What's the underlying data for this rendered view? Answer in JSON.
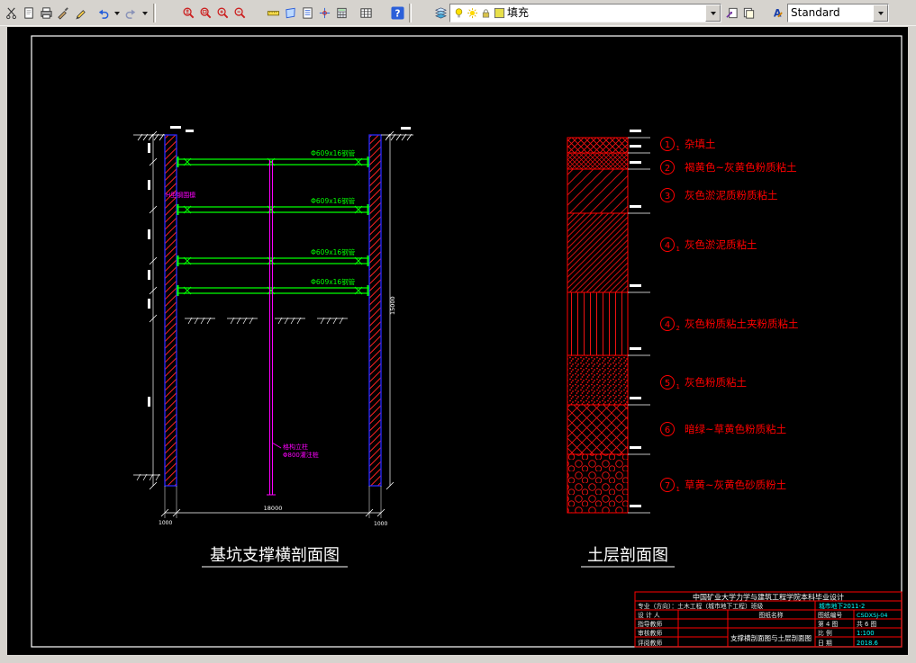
{
  "toolbar": {
    "layer_combo_value": "填充",
    "style_combo_value": "Standard",
    "help_glyph": "?",
    "text_style_glyph": "A",
    "icons": {
      "cut-icon": "scissors",
      "new-icon": "blank page",
      "print-icon": "printer",
      "matchprop-icon": "paint brush",
      "pencil-icon": "pencil",
      "undo-icon": "curved arrow left",
      "redo-icon": "curved arrow right",
      "zoom-realtime-icon": "red magnifier plus-minus",
      "zoom-window-icon": "red magnifier with window",
      "zoom-in-icon": "red magnifier plus",
      "zoom-out-icon": "red magnifier minus",
      "measure-icon": "ruler",
      "area-icon": "polygon",
      "list-icon": "page with lines",
      "point-icon": "crosshair",
      "calc-icon": "calculator grid",
      "table-icon": "table grid",
      "help-icon": "blue question mark",
      "layers-stack-icon": "stacked sheets",
      "bulb-icon": "lightbulb on",
      "sun-icon": "sun",
      "lock-icon": "padlock",
      "layer-color-swatch": "yellow square",
      "dropdown-arrow-icon": "down triangle"
    }
  },
  "drawing": {
    "section": {
      "title": "基坑支撑横剖面图",
      "strut_labels": [
        "Φ609x16钢管",
        "Φ609x16钢管",
        "Φ609x16钢管",
        "Φ609x16钢管"
      ],
      "waler_label": "H型钢围檩",
      "pile_label_line1": "格构立柱",
      "pile_label_line2": "Φ800灌注桩",
      "dim_bottom_left": "1000",
      "dim_bottom_center": "18000",
      "dim_bottom_right": "1000",
      "dim_right": "15000"
    },
    "soil": {
      "title": "土层剖面图",
      "layers": [
        {
          "num": "1",
          "sub": "1",
          "label": "杂填土",
          "pattern": "crosshatch"
        },
        {
          "num": "2",
          "sub": "",
          "label": "褐黄色~灰黄色粉质粘土",
          "pattern": "crosshatch-fine"
        },
        {
          "num": "3",
          "sub": "",
          "label": "灰色淤泥质粉质粘土",
          "pattern": "diagonal"
        },
        {
          "num": "4",
          "sub": "1",
          "label": "灰色淤泥质粘土",
          "pattern": "diagonal-dense"
        },
        {
          "num": "4",
          "sub": "2",
          "label": "灰色粉质粘土夹粉质粘土",
          "pattern": "vertical-lines"
        },
        {
          "num": "5",
          "sub": "1",
          "label": "灰色粉质粘土",
          "pattern": "dense-dots"
        },
        {
          "num": "6",
          "sub": "",
          "label": "暗绿~草黄色粉质粘土",
          "pattern": "cross-marks"
        },
        {
          "num": "7",
          "sub": "1",
          "label": "草黄~灰黄色砂质粉土",
          "pattern": "pebbles"
        }
      ]
    },
    "title_block": {
      "school_line": "中国矿业大学力学与建筑工程学院本科毕业设计",
      "major_label": "专业（方向）：土木工程（城市地下工程）班级",
      "major_value": "城市地下2011-2",
      "designer_label": "设 计 人",
      "advisor_label": "指导教师",
      "checker_label": "审核教师",
      "reviewer_label": "评阅教师",
      "name_label": "图纸名称",
      "sheet_no_label": "图纸编号",
      "sheet_no_value": "CSDXSJ-04",
      "sheet_index": "第 4 图",
      "sheet_total": "共 6 图",
      "drawing_name": "支撑横剖面图与土层剖面图",
      "scale_label": "比 例",
      "scale_value": "1:100",
      "date_label": "日 期",
      "date_value": "2018.6"
    }
  },
  "colors": {
    "strut": "#00ff00",
    "wall_edge": "#2a2aff",
    "hatch": "#ff2222",
    "pile": "#ff00ff",
    "dimensions": "#ffffff",
    "soil_outline": "#ff0000",
    "callout": "#ff0000",
    "title_text": "#ffffff",
    "title_block_lines": "#ff0000",
    "title_block_values": "#00ffff",
    "canvas_bg": "#000000",
    "toolbar_bg": "#d6d3ce"
  }
}
